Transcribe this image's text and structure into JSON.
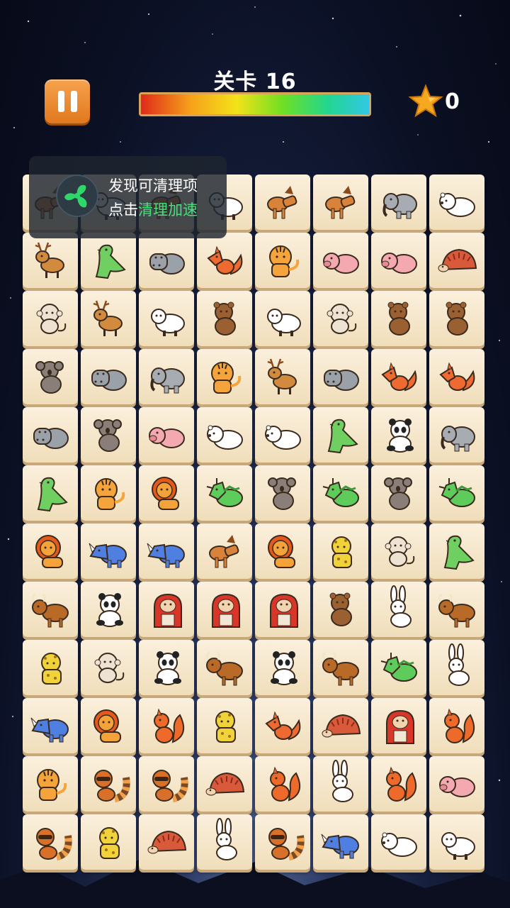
{
  "header": {
    "level_label": "关卡 16",
    "progress_fraction": 1.0,
    "star_count": "0"
  },
  "toast": {
    "line1": "发现可清理项",
    "line2_prefix": "点击",
    "line2_highlight": "清理加速"
  },
  "colors": {
    "tile_face": "#f6e8cc",
    "pause_button": "#ef8a2e",
    "toast_highlight": "#44e27a",
    "star": "#f6a81e"
  },
  "board": {
    "columns": 8,
    "rows": [
      [
        "horse",
        "sheep",
        "horse",
        "sheep",
        "horse",
        "horse",
        "elephant",
        "polar-bear"
      ],
      [
        "deer",
        "dinosaur",
        "hippo",
        "fox",
        "tiger",
        "pig",
        "pig",
        "hedgehog"
      ],
      [
        "monkey",
        "deer",
        "sheep",
        "bear",
        "sheep",
        "monkey",
        "bear",
        "bear"
      ],
      [
        "koala",
        "hippo",
        "elephant",
        "tiger",
        "deer",
        "hippo",
        "fox",
        "fox"
      ],
      [
        "hippo",
        "koala",
        "pig",
        "polar-bear",
        "polar-bear",
        "dinosaur",
        "panda",
        "elephant"
      ],
      [
        "dinosaur",
        "tiger",
        "lion",
        "triceratops",
        "koala",
        "triceratops",
        "koala",
        "triceratops"
      ],
      [
        "lion",
        "rhino",
        "rhino",
        "horse",
        "lion",
        "leopard",
        "monkey",
        "dinosaur"
      ],
      [
        "bull",
        "panda",
        "gorilla",
        "gorilla",
        "gorilla",
        "bear",
        "rabbit",
        "bull"
      ],
      [
        "leopard",
        "monkey",
        "panda",
        "bull",
        "panda",
        "bull",
        "triceratops",
        "rabbit"
      ],
      [
        "rhino",
        "lion",
        "squirrel",
        "leopard",
        "fox",
        "hedgehog",
        "gorilla",
        "squirrel"
      ],
      [
        "tiger",
        "raccoon",
        "raccoon",
        "hedgehog",
        "squirrel",
        "rabbit",
        "squirrel",
        "pig"
      ],
      [
        "raccoon",
        "leopard",
        "hedgehog",
        "rabbit",
        "raccoon",
        "rhino",
        "polar-bear",
        "sheep"
      ]
    ]
  }
}
